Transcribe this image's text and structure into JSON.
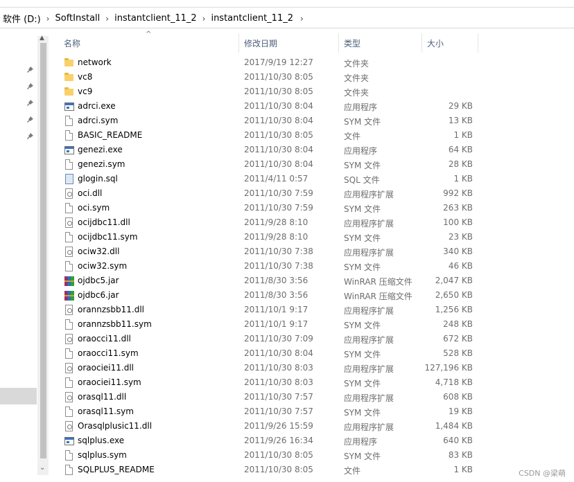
{
  "breadcrumb": [
    "软件 (D:)",
    "SoftInstall",
    "instantclient_11_2",
    "instantclient_11_2"
  ],
  "columns": {
    "name": "名称",
    "date": "修改日期",
    "type": "类型",
    "size": "大小"
  },
  "files": [
    {
      "name": "network",
      "date": "2017/9/19 12:27",
      "type": "文件夹",
      "size": "",
      "icon": "folder-icon"
    },
    {
      "name": "vc8",
      "date": "2011/10/30 8:05",
      "type": "文件夹",
      "size": "",
      "icon": "folder-icon"
    },
    {
      "name": "vc9",
      "date": "2011/10/30 8:05",
      "type": "文件夹",
      "size": "",
      "icon": "folder-icon"
    },
    {
      "name": "adrci.exe",
      "date": "2011/10/30 8:04",
      "type": "应用程序",
      "size": "29 KB",
      "icon": "exe-icon"
    },
    {
      "name": "adrci.sym",
      "date": "2011/10/30 8:04",
      "type": "SYM 文件",
      "size": "13 KB",
      "icon": "file-icon"
    },
    {
      "name": "BASIC_README",
      "date": "2011/10/30 8:05",
      "type": "文件",
      "size": "1 KB",
      "icon": "file-icon"
    },
    {
      "name": "genezi.exe",
      "date": "2011/10/30 8:04",
      "type": "应用程序",
      "size": "64 KB",
      "icon": "exe-icon"
    },
    {
      "name": "genezi.sym",
      "date": "2011/10/30 8:04",
      "type": "SYM 文件",
      "size": "28 KB",
      "icon": "file-icon"
    },
    {
      "name": "glogin.sql",
      "date": "2011/4/11 0:57",
      "type": "SQL 文件",
      "size": "1 KB",
      "icon": "sql-icon"
    },
    {
      "name": "oci.dll",
      "date": "2011/10/30 7:59",
      "type": "应用程序扩展",
      "size": "992 KB",
      "icon": "dll-icon"
    },
    {
      "name": "oci.sym",
      "date": "2011/10/30 7:59",
      "type": "SYM 文件",
      "size": "263 KB",
      "icon": "file-icon"
    },
    {
      "name": "ocijdbc11.dll",
      "date": "2011/9/28 8:10",
      "type": "应用程序扩展",
      "size": "100 KB",
      "icon": "dll-icon"
    },
    {
      "name": "ocijdbc11.sym",
      "date": "2011/9/28 8:10",
      "type": "SYM 文件",
      "size": "23 KB",
      "icon": "file-icon"
    },
    {
      "name": "ociw32.dll",
      "date": "2011/10/30 7:38",
      "type": "应用程序扩展",
      "size": "340 KB",
      "icon": "dll-icon"
    },
    {
      "name": "ociw32.sym",
      "date": "2011/10/30 7:38",
      "type": "SYM 文件",
      "size": "46 KB",
      "icon": "file-icon"
    },
    {
      "name": "ojdbc5.jar",
      "date": "2011/8/30 3:56",
      "type": "WinRAR 压缩文件",
      "size": "2,047 KB",
      "icon": "winrar-icon"
    },
    {
      "name": "ojdbc6.jar",
      "date": "2011/8/30 3:56",
      "type": "WinRAR 压缩文件",
      "size": "2,650 KB",
      "icon": "winrar-icon"
    },
    {
      "name": "orannzsbb11.dll",
      "date": "2011/10/1 9:17",
      "type": "应用程序扩展",
      "size": "1,256 KB",
      "icon": "dll-icon"
    },
    {
      "name": "orannzsbb11.sym",
      "date": "2011/10/1 9:17",
      "type": "SYM 文件",
      "size": "248 KB",
      "icon": "file-icon"
    },
    {
      "name": "oraocci11.dll",
      "date": "2011/10/30 7:09",
      "type": "应用程序扩展",
      "size": "672 KB",
      "icon": "dll-icon"
    },
    {
      "name": "oraocci11.sym",
      "date": "2011/10/30 8:04",
      "type": "SYM 文件",
      "size": "528 KB",
      "icon": "file-icon"
    },
    {
      "name": "oraociei11.dll",
      "date": "2011/10/30 8:03",
      "type": "应用程序扩展",
      "size": "127,196 KB",
      "icon": "dll-icon"
    },
    {
      "name": "oraociei11.sym",
      "date": "2011/10/30 8:03",
      "type": "SYM 文件",
      "size": "4,718 KB",
      "icon": "file-icon"
    },
    {
      "name": "orasql11.dll",
      "date": "2011/10/30 7:57",
      "type": "应用程序扩展",
      "size": "608 KB",
      "icon": "dll-icon"
    },
    {
      "name": "orasql11.sym",
      "date": "2011/10/30 7:57",
      "type": "SYM 文件",
      "size": "19 KB",
      "icon": "file-icon"
    },
    {
      "name": "Orasqlplusic11.dll",
      "date": "2011/9/26 15:59",
      "type": "应用程序扩展",
      "size": "1,484 KB",
      "icon": "dll-icon"
    },
    {
      "name": "sqlplus.exe",
      "date": "2011/9/26 16:34",
      "type": "应用程序",
      "size": "640 KB",
      "icon": "exe-icon"
    },
    {
      "name": "sqlplus.sym",
      "date": "2011/10/30 8:05",
      "type": "SYM 文件",
      "size": "83 KB",
      "icon": "file-icon"
    },
    {
      "name": "SQLPLUS_README",
      "date": "2011/10/30 8:05",
      "type": "文件",
      "size": "1 KB",
      "icon": "file-icon"
    }
  ],
  "watermark": "CSDN @梁萌",
  "colors": {
    "header_text": "#4c607a",
    "detail_text": "#6d6d6d",
    "selection": "#d9d9d9"
  }
}
